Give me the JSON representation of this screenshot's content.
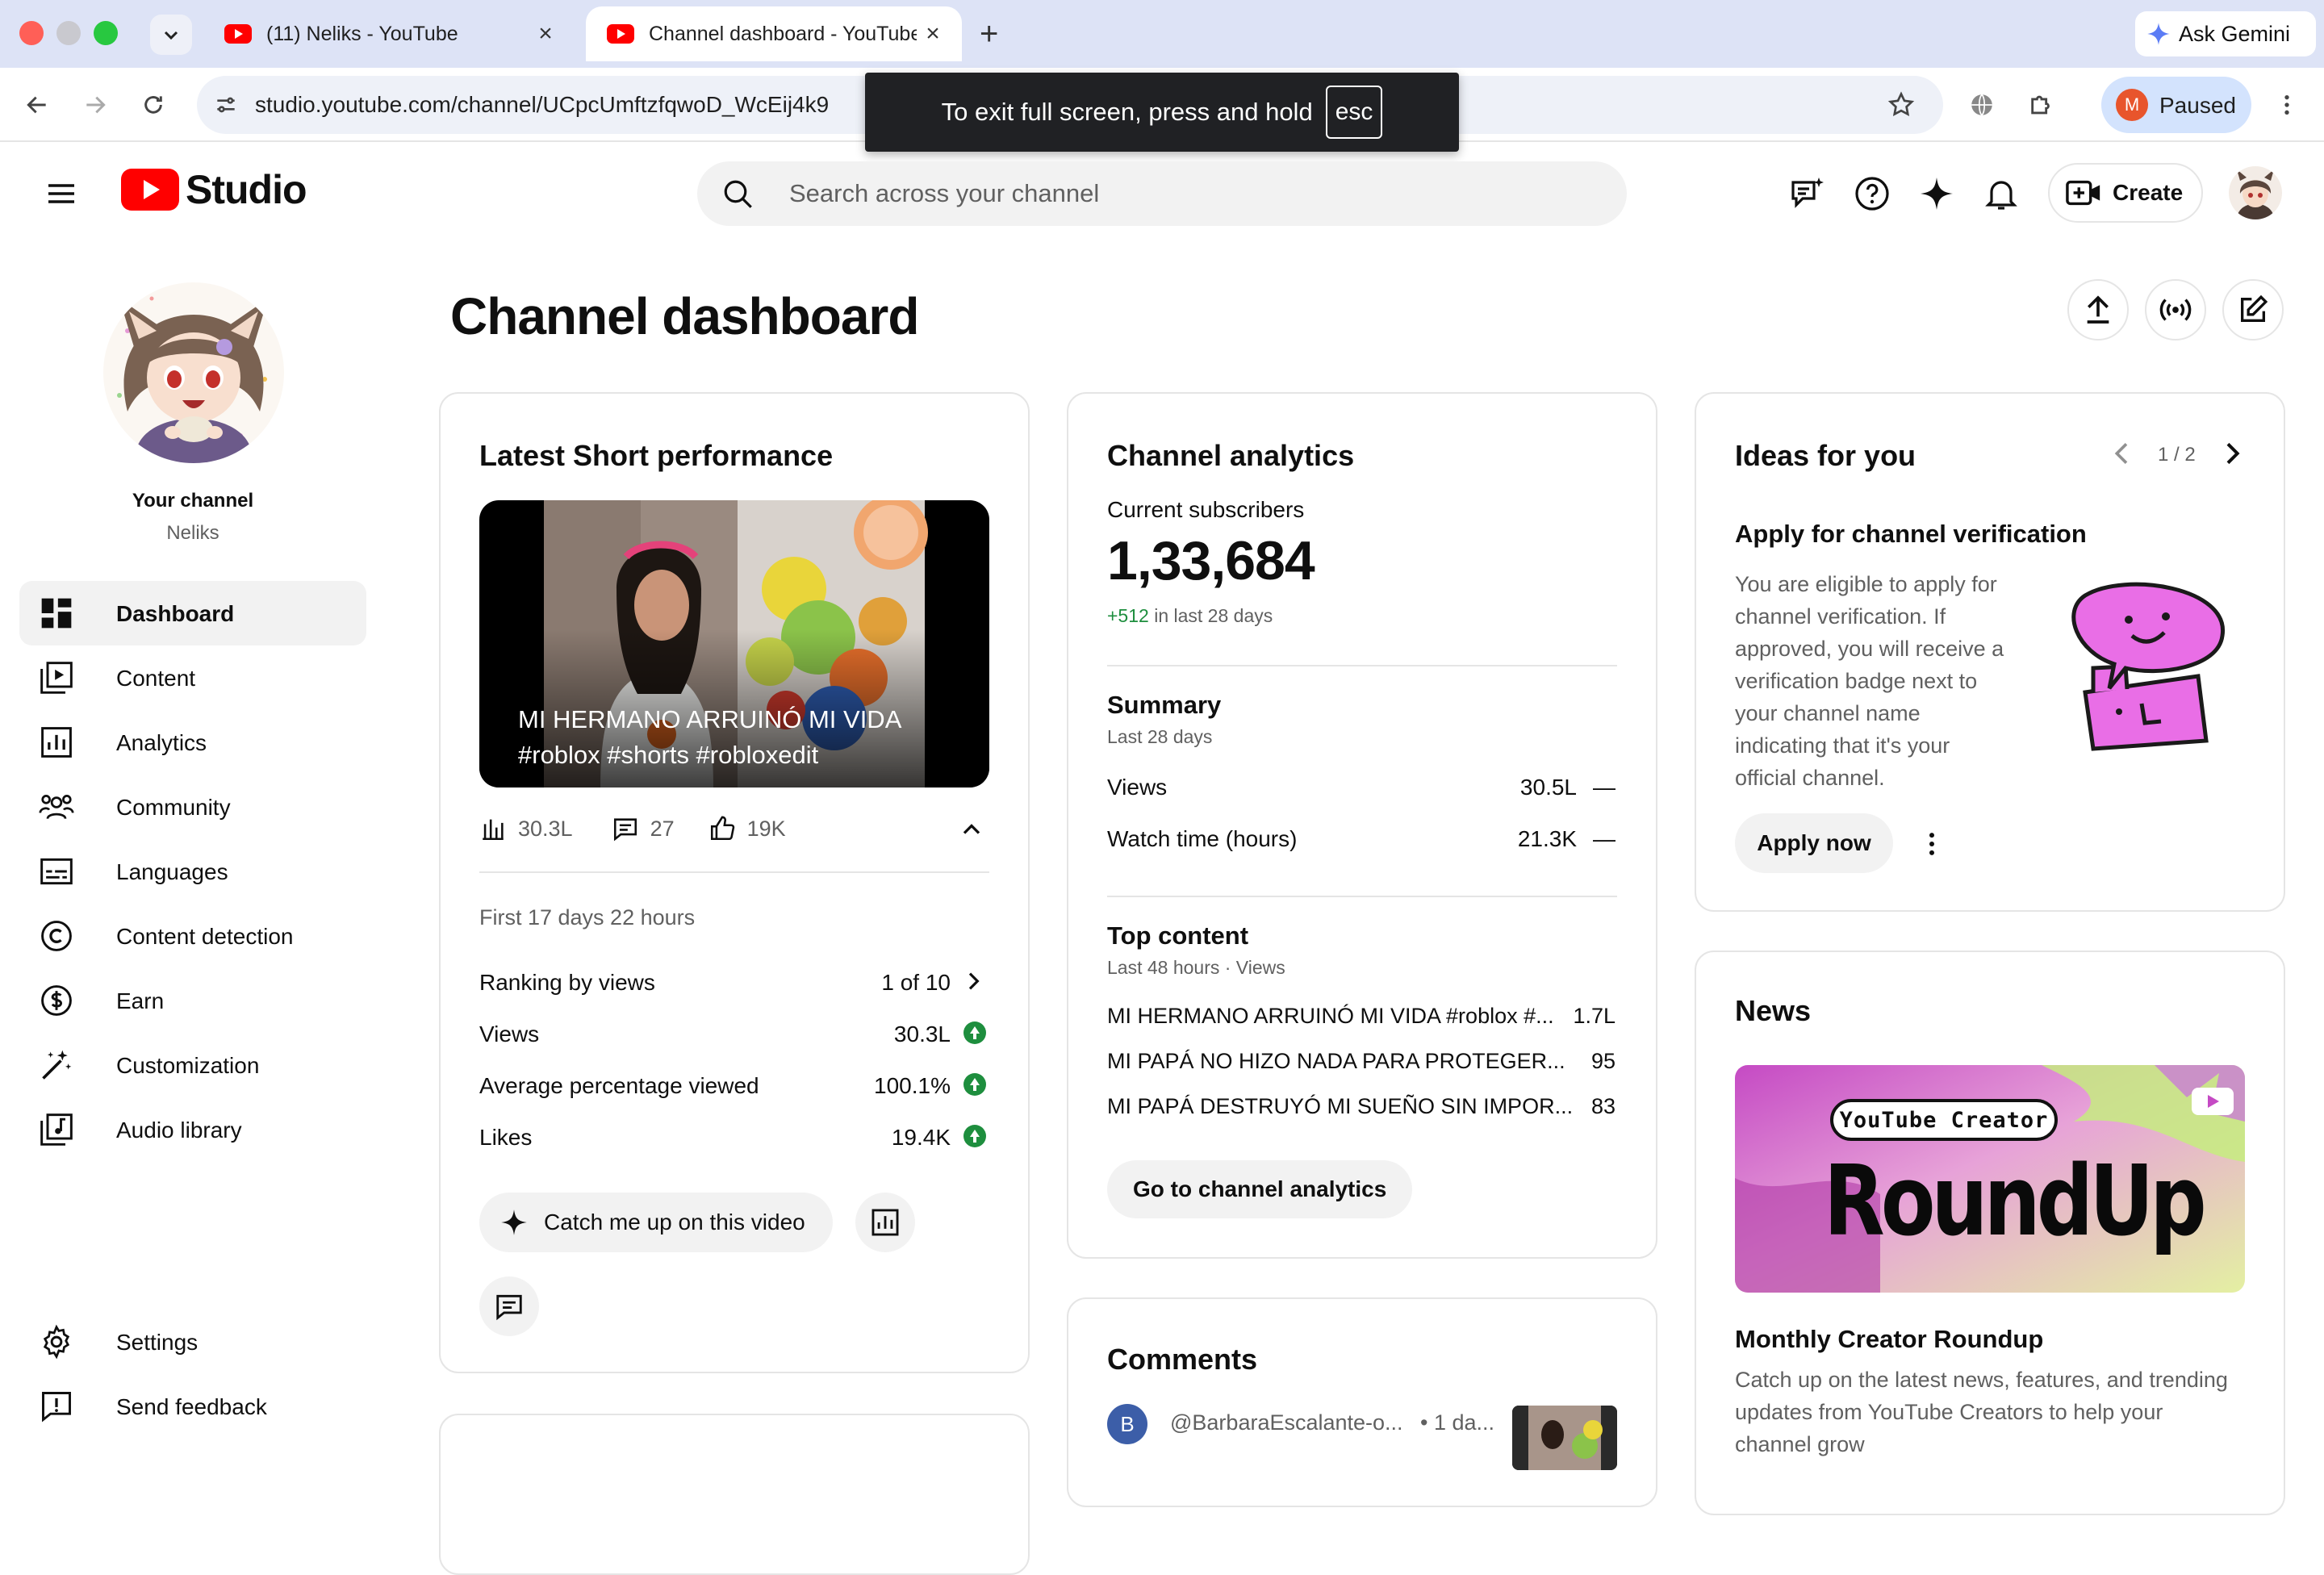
{
  "browser": {
    "tabs": [
      {
        "label": "(11) Neliks - YouTube",
        "active": false
      },
      {
        "label": "Channel dashboard - YouTube",
        "active": true
      }
    ],
    "ask_gemini": "Ask Gemini",
    "url": "studio.youtube.com/channel/UCpcUmftzfqwoD_WcEij4k9",
    "profile_initial": "M",
    "profile_status": "Paused",
    "fullscreen_toast": {
      "text": "To exit full screen, press and hold",
      "key": "esc"
    }
  },
  "header": {
    "logo_text": "Studio",
    "search_placeholder": "Search across your channel",
    "create_label": "Create"
  },
  "sidebar": {
    "channel_label": "Your channel",
    "channel_name": "Neliks",
    "items": [
      {
        "label": "Dashboard",
        "icon": "dashboard-icon",
        "active": true
      },
      {
        "label": "Content",
        "icon": "content-icon"
      },
      {
        "label": "Analytics",
        "icon": "analytics-icon"
      },
      {
        "label": "Community",
        "icon": "community-icon"
      },
      {
        "label": "Languages",
        "icon": "languages-icon"
      },
      {
        "label": "Content detection",
        "icon": "copyright-icon"
      },
      {
        "label": "Earn",
        "icon": "earn-icon"
      },
      {
        "label": "Customization",
        "icon": "magic-wand-icon"
      },
      {
        "label": "Audio library",
        "icon": "audio-library-icon"
      }
    ],
    "settings_label": "Settings",
    "feedback_label": "Send feedback"
  },
  "page_title": "Channel dashboard",
  "latest_short": {
    "title": "Latest Short performance",
    "video_title_line1": "MI HERMANO ARRUINÓ MI VIDA",
    "video_title_line2": "#roblox #shorts #robloxedit",
    "stat_views": "30.3L",
    "stat_comments": "27",
    "stat_likes": "19K",
    "period": "First 17 days 22 hours",
    "rows": [
      {
        "label": "Ranking by views",
        "value": "1 of 10"
      },
      {
        "label": "Views",
        "value": "30.3L"
      },
      {
        "label": "Average percentage viewed",
        "value": "100.1%"
      },
      {
        "label": "Likes",
        "value": "19.4K"
      }
    ],
    "catch_up_label": "Catch me up on this video"
  },
  "channel_analytics": {
    "title": "Channel analytics",
    "subs_label": "Current subscribers",
    "subs_value": "1,33,684",
    "subs_change": "+512",
    "subs_change_suffix": "in last 28 days",
    "summary_title": "Summary",
    "summary_period": "Last 28 days",
    "summary_rows": [
      {
        "label": "Views",
        "value": "30.5L",
        "trend": "—"
      },
      {
        "label": "Watch time (hours)",
        "value": "21.3K",
        "trend": "—"
      }
    ],
    "top_title": "Top content",
    "top_period": "Last 48 hours · Views",
    "top_rows": [
      {
        "title": "MI HERMANO ARRUINÓ MI VIDA #roblox #...",
        "views": "1.7L"
      },
      {
        "title": "MI PAPÁ NO HIZO NADA PARA PROTEGER...",
        "views": "95"
      },
      {
        "title": "MI PAPÁ DESTRUYÓ MI SUEÑO SIN IMPOR...",
        "views": "83"
      }
    ],
    "go_label": "Go to channel analytics"
  },
  "comments": {
    "title": "Comments",
    "first": {
      "avatar": "B",
      "author": "@BarbaraEscalante-o...",
      "time": "• 1 da..."
    }
  },
  "ideas": {
    "title": "Ideas for you",
    "pager": "1 / 2",
    "heading": "Apply for channel verification",
    "lines": [
      "You are eligible to apply for",
      "channel verification. If",
      "approved, you will receive a",
      "verification badge next to",
      "your channel name",
      "indicating that it's your",
      "official channel."
    ],
    "apply_label": "Apply now"
  },
  "news": {
    "title": "News",
    "banner_tag": "YouTube Creator",
    "banner_title": "RoundUp",
    "article_title": "Monthly Creator Roundup",
    "lines": [
      "Catch up on the latest news, features, and trending",
      "updates from YouTube Creators to help your",
      "channel grow"
    ]
  },
  "colors": {
    "brand_red": "#ff0000",
    "positive": "#1e8e3e",
    "accent_blue": "#065fd4"
  }
}
